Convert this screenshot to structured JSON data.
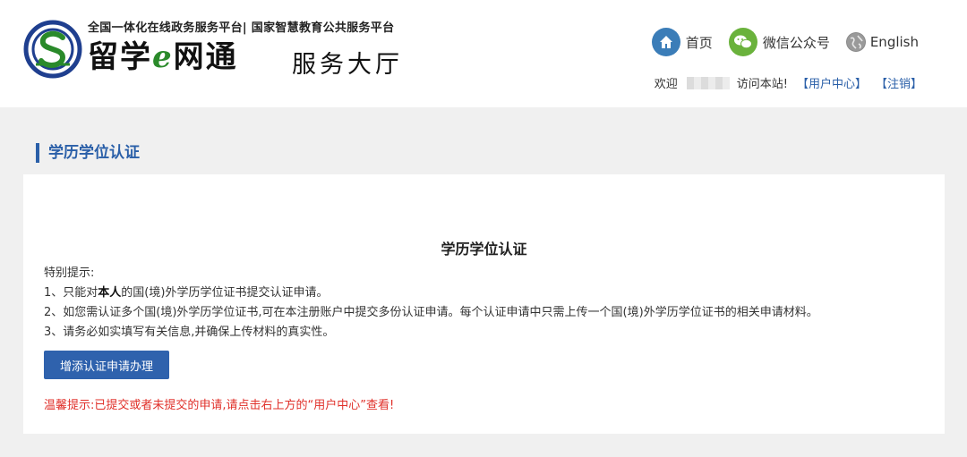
{
  "header": {
    "tagline": "全国一体化在线政务服务平台| 国家智慧教育公共服务平台",
    "brand_part1": "留学",
    "brand_e": "e",
    "brand_part2": "网通",
    "brand_sub": "服务大厅"
  },
  "topnav": {
    "home": "首页",
    "wechat": "微信公众号",
    "english": "English"
  },
  "userbar": {
    "welcome": "欢迎",
    "visit": "访问本站!",
    "user_center": "【用户中心】",
    "logout": "【注销】"
  },
  "section": {
    "title": "学历学位认证"
  },
  "card": {
    "title": "学历学位认证",
    "notice_label": "特别提示:",
    "notice1_prefix": "1、只能对",
    "notice1_bold": "本人",
    "notice1_suffix": "的国(境)外学历学位证书提交认证申请。",
    "notice2": "2、如您需认证多个国(境)外学历学位证书,可在本注册账户中提交多份认证申请。每个认证申请中只需上传一个国(境)外学历学位证书的相关申请材料。",
    "notice3": "3、请务必如实填写有关信息,并确保上传材料的真实性。",
    "apply_button": "增添认证申请办理",
    "warm_tip": "温馨提示:已提交或者未提交的申请,请点击右上方的“用户中心”查看!"
  },
  "colors": {
    "accent": "#2a5fa8",
    "button": "#2f62ad",
    "warning": "#e0302a",
    "home_icon": "#3b7db8",
    "wechat_icon": "#6ab23c"
  },
  "icons": {
    "home": "home-icon",
    "wechat": "wechat-icon",
    "globe": "globe-icon",
    "logo": "logo-mark-icon"
  }
}
